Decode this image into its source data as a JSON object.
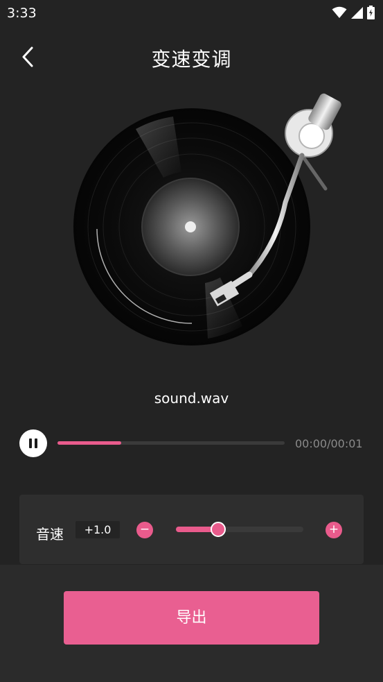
{
  "status_bar": {
    "time": "3:33"
  },
  "header": {
    "title": "变速变调"
  },
  "player": {
    "file_name": "sound.wav",
    "time_display": "00:00/00:01",
    "progress": 0.28
  },
  "speed_control": {
    "label": "音速",
    "value": "+1.0",
    "minus_symbol": "−",
    "plus_symbol": "+",
    "slider_level": 0.33
  },
  "footer": {
    "export_label": "导出"
  },
  "colors": {
    "accent": "#e95b8c",
    "background": "#232323",
    "panel": "#2e2e2e"
  }
}
